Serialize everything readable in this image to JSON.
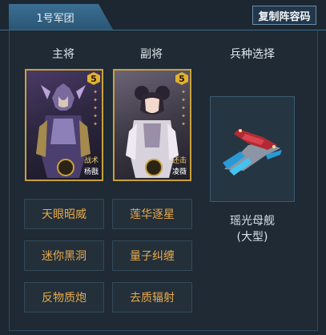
{
  "header": {
    "tab_label": "1号军团",
    "copy_button": "复制阵容码"
  },
  "columns": {
    "main_general": "主将",
    "vice_general": "副将",
    "unit_select": "兵种选择"
  },
  "heroes": {
    "main": {
      "rank": "5",
      "skill_tag": "战术",
      "name": "杨戬"
    },
    "vice": {
      "rank": "5",
      "skill_tag": "还击",
      "name": "凌薇"
    }
  },
  "unit": {
    "name_line1": "瑶光母舰",
    "name_line2": "(大型)",
    "icon": "spaceship-icon"
  },
  "skills": [
    "天眼昭威",
    "莲华逐星",
    "迷你黑洞",
    "量子纠缠",
    "反物质炮",
    "去质辐射"
  ],
  "colors": {
    "accent": "#3a6f93",
    "skill_text": "#e9a94b",
    "card_border": "#c9a13a"
  }
}
